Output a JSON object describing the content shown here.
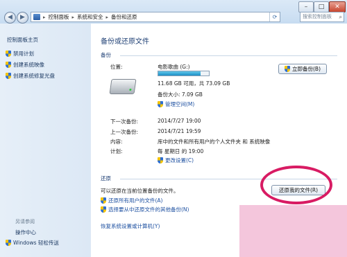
{
  "window": {
    "min_label": "–",
    "max_label": "□",
    "close_label": "✕",
    "back_icon": "back-arrow-icon",
    "forward_icon": "forward-arrow-icon"
  },
  "address": {
    "breadcrumb": [
      "控制面板",
      "系统和安全",
      "备份和还原"
    ],
    "separator": "▸"
  },
  "search": {
    "placeholder": "搜索控制面板"
  },
  "sidebar": {
    "home": "控制面板主页",
    "items": [
      {
        "label": "禁用计划"
      },
      {
        "label": "创建系统映像"
      },
      {
        "label": "创建系统修复光盘"
      }
    ],
    "see_also": "另请参阅",
    "see_also_items": [
      {
        "label": "操作中心"
      },
      {
        "label": "Windows 轻松传送"
      }
    ]
  },
  "main": {
    "title": "备份或还原文件",
    "backup": {
      "header": "备份",
      "location_label": "位置:",
      "location_value": "电影歌曲 (G:)",
      "usage_fraction": 0.84,
      "space_text": "11.68 GB 可用，共 73.09 GB",
      "backup_size": "备份大小: 7.09 GB",
      "manage_space": "管理空间(M)",
      "backup_now": "立即备份(B)",
      "next_label": "下一次备份:",
      "next_value": "2014/7/27 19:00",
      "last_label": "上一次备份:",
      "last_value": "2014/7/21 19:59",
      "contents_label": "内容:",
      "contents_value": "库中的文件和所有用户的个人文件夹 和 系统映像",
      "schedule_label": "计划:",
      "schedule_value": "每 星期日 的 19:00",
      "change_settings": "更改设置(C)"
    },
    "restore": {
      "header": "还原",
      "desc": "可以还原在当前位置备份的文件。",
      "restore_all": "还原所有用户的文件(A)",
      "select_other": "选择要从中还原文件的其他备份(N)",
      "recover_system": "恢复系统设置或计算机(Y)",
      "restore_mine": "还原我的文件(R)"
    }
  },
  "colors": {
    "accent": "#1c4fa0",
    "highlight_circle": "#d81b63"
  }
}
